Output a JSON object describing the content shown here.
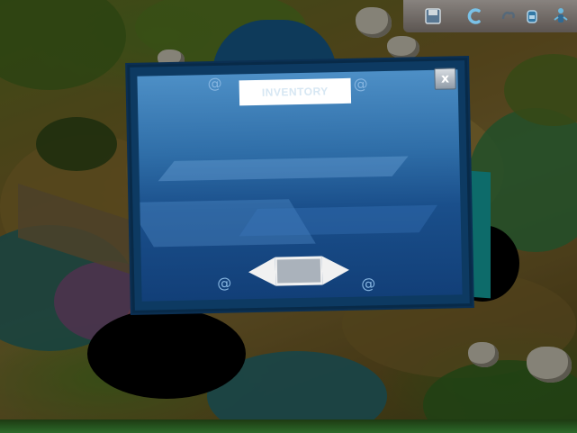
{
  "dialog": {
    "title": "INVENTORY",
    "close_label": "x",
    "close_icon": "close-icon"
  },
  "pager": {
    "prev_icon": "arrow-left-icon",
    "next_icon": "arrow-right-icon"
  },
  "toolbar": {
    "buttons": [
      {
        "icon": "save-disk-icon"
      },
      {
        "icon": "refresh-icon"
      },
      {
        "icon": "hand-icon"
      },
      {
        "icon": "character-icon"
      }
    ],
    "accent_color": "#7fd0ff"
  },
  "colors": {
    "dialog_frame": "#0d3a62",
    "dialog_top": "#4d8fc6",
    "dialog_bottom": "#123f78"
  }
}
